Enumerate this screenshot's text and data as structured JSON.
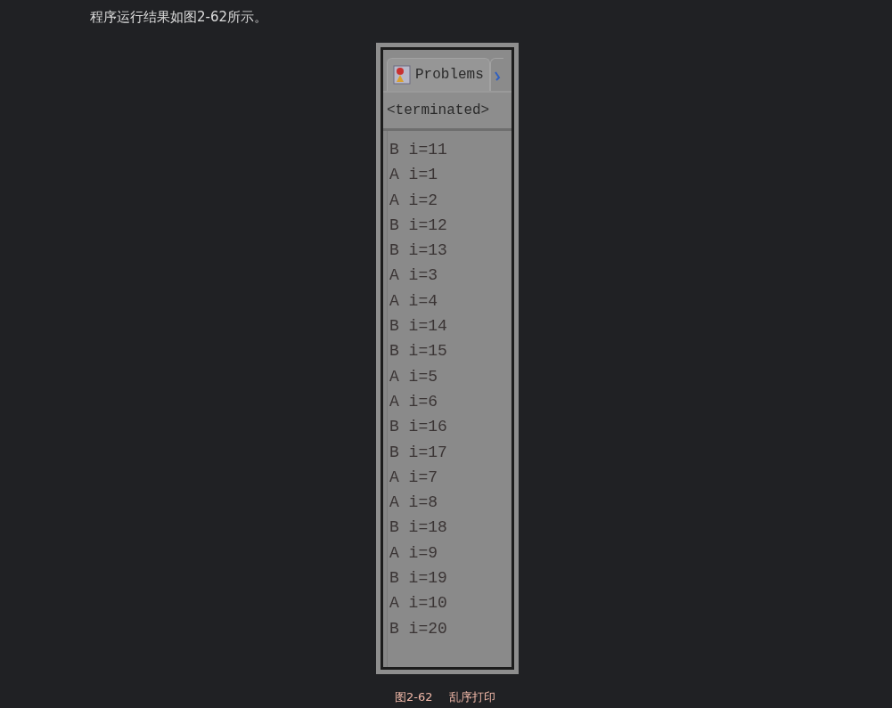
{
  "paragraph": "程序运行结果如图2-62所示。",
  "figure": {
    "tabs": [
      {
        "label": "Problems",
        "selected": true
      }
    ],
    "status": "<terminated>",
    "output": [
      "B i=11",
      "A i=1",
      "A i=2",
      "B i=12",
      "B i=13",
      "A i=3",
      "A i=4",
      "B i=14",
      "B i=15",
      "A i=5",
      "A i=6",
      "B i=16",
      "B i=17",
      "A i=7",
      "A i=8",
      "B i=18",
      "A i=9",
      "B i=19",
      "A i=10",
      "B i=20"
    ]
  },
  "caption": {
    "number": "图2-62",
    "title": "乱序打印"
  }
}
